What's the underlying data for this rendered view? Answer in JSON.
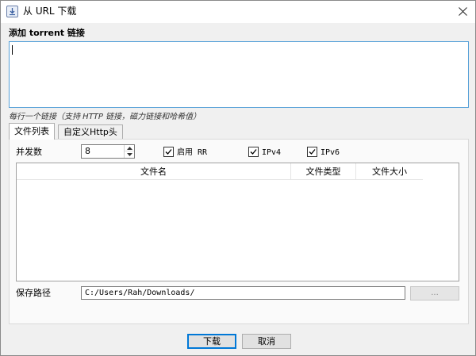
{
  "window": {
    "title": "从 URL 下载",
    "app_icon": "download-doc-icon",
    "close_icon": "close-icon"
  },
  "links": {
    "heading": "添加 torrent 链接",
    "value": "",
    "hint": "每行一个链接（支持 HTTP 链接，磁力链接和哈希值）"
  },
  "tabs": [
    {
      "label": "文件列表",
      "active": true
    },
    {
      "label": "自定义Http头",
      "active": false
    }
  ],
  "options": {
    "concurrency_label": "并发数",
    "concurrency_value": "8",
    "checkboxes": [
      {
        "label": "启用 RR",
        "checked": true
      },
      {
        "label": "IPv4",
        "checked": true
      },
      {
        "label": "IPv6",
        "checked": true
      }
    ]
  },
  "file_table": {
    "columns": [
      "文件名",
      "文件类型",
      "文件大小"
    ],
    "rows": []
  },
  "save_path": {
    "label": "保存路径",
    "value": "C:/Users/Rah/Downloads/",
    "browse_label": "..."
  },
  "buttons": {
    "download": "下载",
    "cancel": "取消"
  },
  "colors": {
    "accent": "#0078d7",
    "focus_border": "#56a0d8"
  }
}
